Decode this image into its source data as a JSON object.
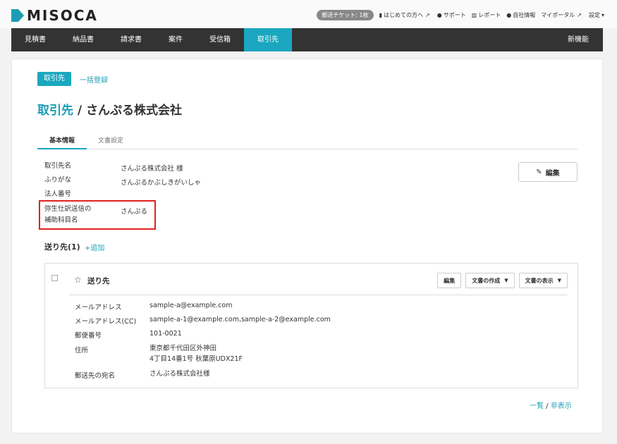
{
  "app": {
    "logo_text": "MISOCA"
  },
  "header": {
    "ticket": "郵送チケット: 1枚",
    "links": [
      {
        "label": "はじめての方へ",
        "icon": "book-icon"
      },
      {
        "label": "サポート",
        "icon": "question-icon"
      },
      {
        "label": "レポート",
        "icon": "chart-icon"
      },
      {
        "label": "自社情報",
        "icon": "user-icon"
      },
      {
        "label": "マイポータル",
        "icon": "external-link-icon"
      },
      {
        "label": "設定",
        "icon": "caret-down-icon"
      }
    ]
  },
  "nav": {
    "items": [
      "見積書",
      "納品書",
      "請求書",
      "案件",
      "受信箱",
      "取引先"
    ],
    "active": "取引先",
    "right_item": "新機能"
  },
  "breadcrumb": {
    "badge": "取引先",
    "link": "一括登録"
  },
  "title": {
    "link": "取引先",
    "separator": " / ",
    "name": "さんぷる株式会社"
  },
  "tabs": {
    "active": "基本情報",
    "second": "文書設定"
  },
  "info": {
    "fields": [
      {
        "label": "取引先名",
        "value": "さんぷる株式会社 様"
      },
      {
        "label": "ふりがな",
        "value": "さんぷるかぶしきがいしゃ"
      },
      {
        "label": "法人番号",
        "value": ""
      },
      {
        "label_line1": "弥生仕訳送信の",
        "label_line2": "補助科目名",
        "value": "さんぷる"
      }
    ],
    "edit_label": "編集"
  },
  "destinations": {
    "heading": "送り先(1)",
    "add_label": "追加",
    "item": {
      "title": "送り先",
      "buttons": {
        "edit": "編集",
        "create": "文書の作成",
        "view": "文書の表示"
      },
      "fields": [
        {
          "label": "メールアドレス",
          "value": "sample-a@example.com"
        },
        {
          "label": "メールアドレス(CC)",
          "value": "sample-a-1@example.com,sample-a-2@example.com"
        },
        {
          "label": "郵便番号",
          "value": "101-0021"
        },
        {
          "label": "住所",
          "value_line1": "東京都千代田区外神田",
          "value_line2": "4丁目14番1号 秋葉原UDX21F"
        },
        {
          "label": "郵送先の宛名",
          "value": "さんぷる株式会社様"
        }
      ]
    }
  },
  "footer": {
    "list": "一覧",
    "sep": " / ",
    "hide": "非表示"
  }
}
